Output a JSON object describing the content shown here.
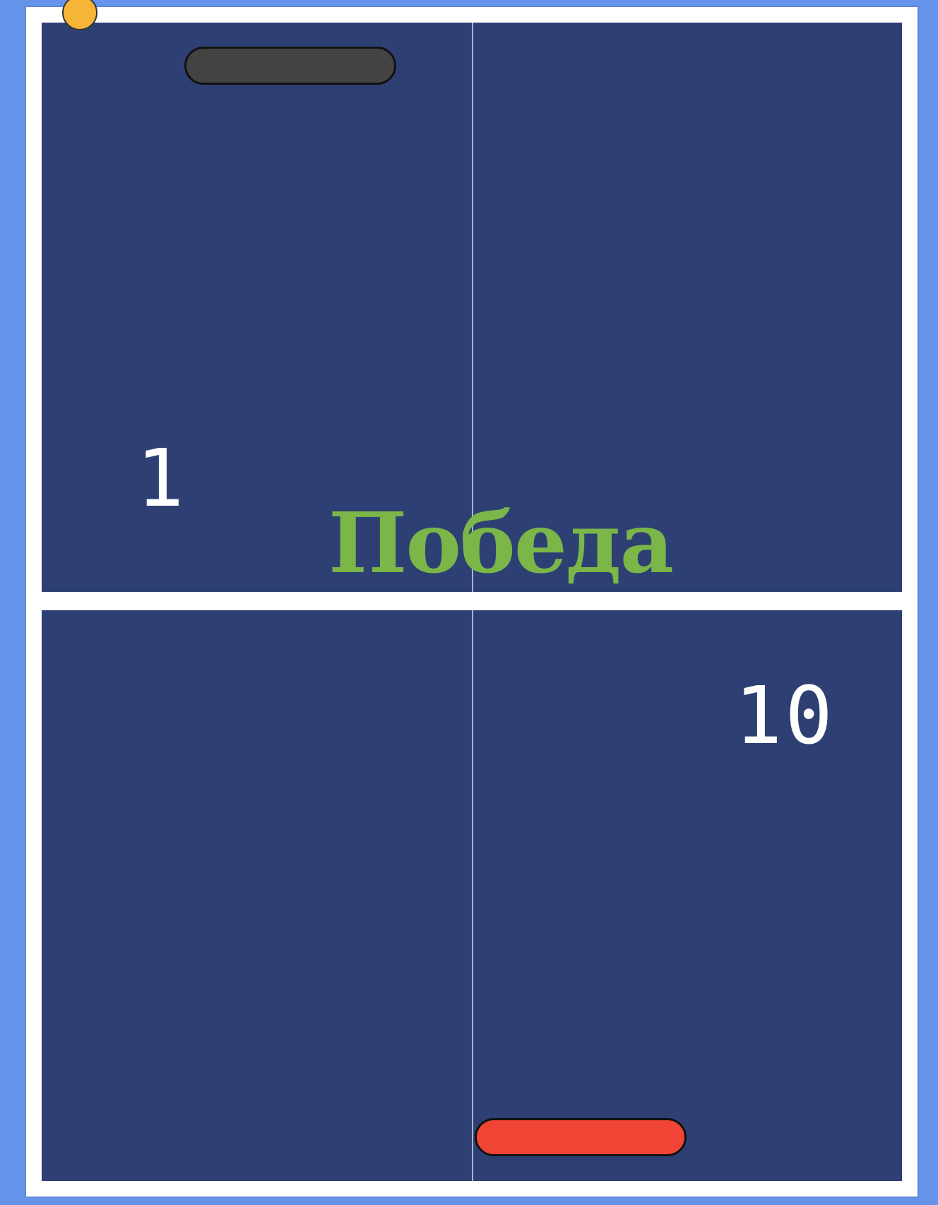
{
  "game": {
    "score_top": "1",
    "score_bottom": "10",
    "status_message": "Победа"
  },
  "colors": {
    "background": "#6495ea",
    "table": "#2e4073",
    "lines": "#ffffff",
    "center_line": "#aab4cc",
    "ball": "#f7b538",
    "paddle_top": "#434343",
    "paddle_bottom": "#f04434",
    "win_text": "#7ab648"
  }
}
